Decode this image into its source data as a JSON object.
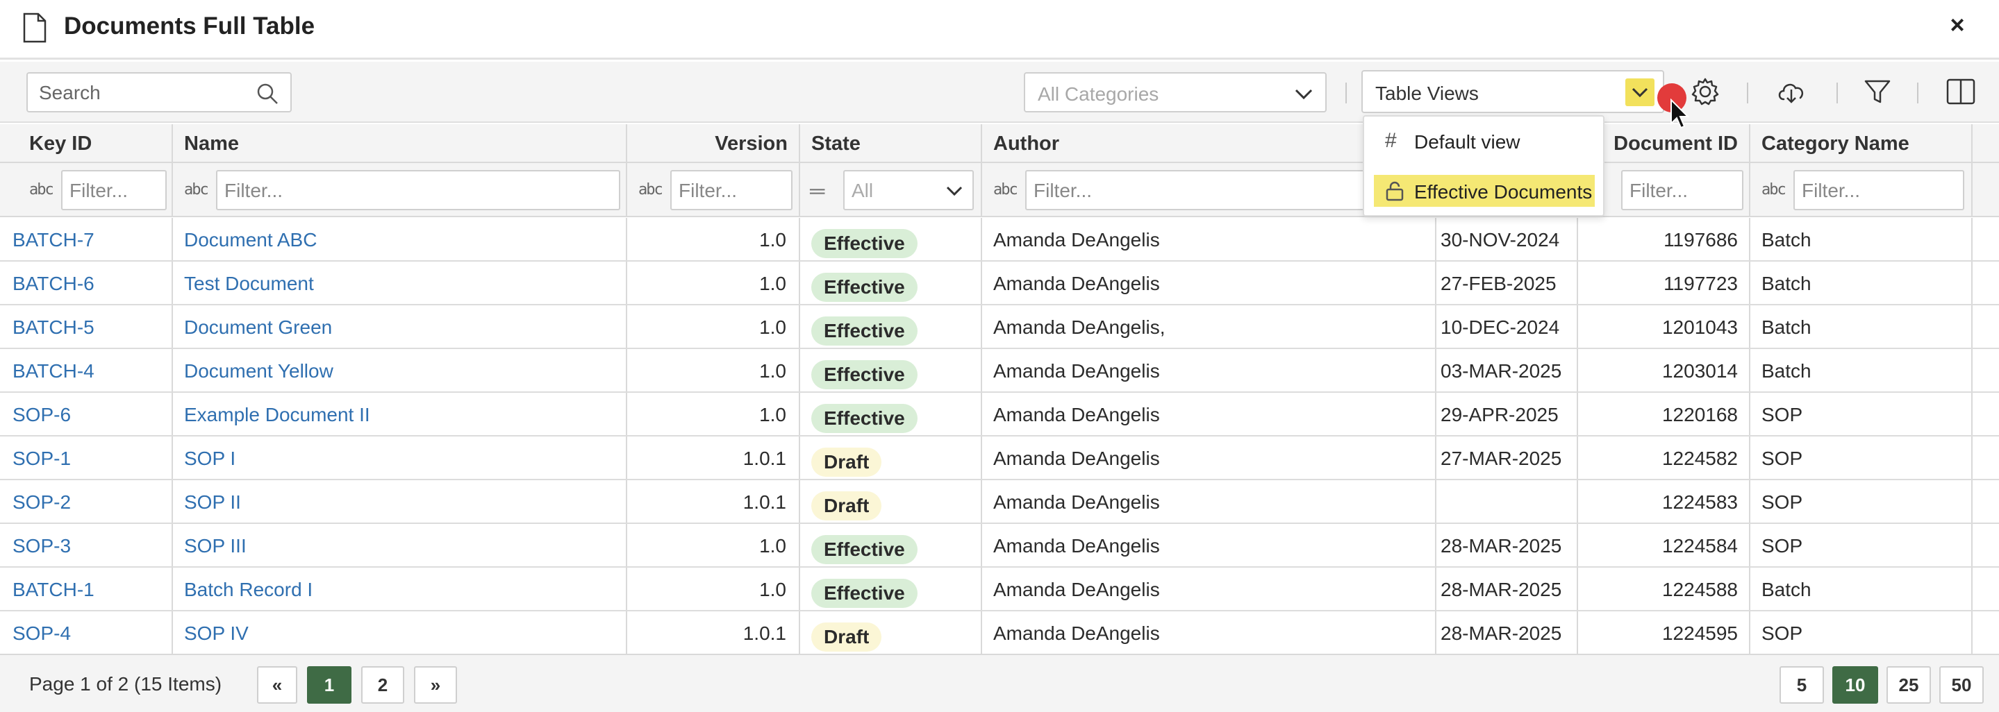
{
  "window": {
    "title": "Documents Full Table",
    "close_label": "×"
  },
  "toolbar": {
    "search_placeholder": "Search",
    "category_select": "All Categories",
    "views_select": "Table Views"
  },
  "views_menu": {
    "items": [
      {
        "icon": "hash-icon",
        "glyph": "#",
        "label": "Default view"
      },
      {
        "icon": "lock-icon",
        "glyph": "🔓",
        "label": "Effective Documents"
      }
    ]
  },
  "table": {
    "columns": [
      {
        "label": "Key ID"
      },
      {
        "label": "Name"
      },
      {
        "label": "Version"
      },
      {
        "label": "State"
      },
      {
        "label": "Author"
      },
      {
        "label": ""
      },
      {
        "label": "Document ID"
      },
      {
        "label": "Category Name"
      }
    ],
    "filter_placeholder": "Filter...",
    "state_filter": "All",
    "abc_glyph": "abc",
    "eq_glyph": "═",
    "rows": [
      {
        "key": "BATCH-7",
        "name": "Document ABC",
        "version": "1.0",
        "state": "Effective",
        "author": "Amanda DeAngelis",
        "date": "30-NOV-2024",
        "doc_id": "1197686",
        "category": "Batch"
      },
      {
        "key": "BATCH-6",
        "name": "Test Document",
        "version": "1.0",
        "state": "Effective",
        "author": "Amanda DeAngelis",
        "date": "27-FEB-2025",
        "doc_id": "1197723",
        "category": "Batch"
      },
      {
        "key": "BATCH-5",
        "name": "Document Green",
        "version": "1.0",
        "state": "Effective",
        "author": "Amanda DeAngelis,",
        "date": "10-DEC-2024",
        "doc_id": "1201043",
        "category": "Batch"
      },
      {
        "key": "BATCH-4",
        "name": "Document Yellow",
        "version": "1.0",
        "state": "Effective",
        "author": "Amanda DeAngelis",
        "date": "03-MAR-2025",
        "doc_id": "1203014",
        "category": "Batch"
      },
      {
        "key": "SOP-6",
        "name": "Example Document II",
        "version": "1.0",
        "state": "Effective",
        "author": "Amanda DeAngelis",
        "date": "29-APR-2025",
        "doc_id": "1220168",
        "category": "SOP"
      },
      {
        "key": "SOP-1",
        "name": "SOP I",
        "version": "1.0.1",
        "state": "Draft",
        "author": "Amanda DeAngelis",
        "date": "27-MAR-2025",
        "doc_id": "1224582",
        "category": "SOP"
      },
      {
        "key": "SOP-2",
        "name": "SOP II",
        "version": "1.0.1",
        "state": "Draft",
        "author": "Amanda DeAngelis",
        "date": "",
        "doc_id": "1224583",
        "category": "SOP"
      },
      {
        "key": "SOP-3",
        "name": "SOP III",
        "version": "1.0",
        "state": "Effective",
        "author": "Amanda DeAngelis",
        "date": "28-MAR-2025",
        "doc_id": "1224584",
        "category": "SOP"
      },
      {
        "key": "BATCH-1",
        "name": "Batch Record I",
        "version": "1.0",
        "state": "Effective",
        "author": "Amanda DeAngelis",
        "date": "28-MAR-2025",
        "doc_id": "1224588",
        "category": "Batch"
      },
      {
        "key": "SOP-4",
        "name": "SOP IV",
        "version": "1.0.1",
        "state": "Draft",
        "author": "Amanda DeAngelis",
        "date": "28-MAR-2025",
        "doc_id": "1224595",
        "category": "SOP"
      }
    ]
  },
  "footer": {
    "page_info": "Page 1 of 2 (15 Items)",
    "first": "«",
    "pages": [
      "1",
      "2"
    ],
    "current_page": "1",
    "last": "»",
    "page_sizes": [
      "5",
      "10",
      "25",
      "50"
    ],
    "current_size": "10"
  },
  "colors": {
    "accent_green": "#3f6b45",
    "link_blue": "#2f6fb0",
    "highlight_yellow": "#f5e874",
    "effective_bg": "#d9eed7",
    "draft_bg": "#fbf6d6"
  }
}
